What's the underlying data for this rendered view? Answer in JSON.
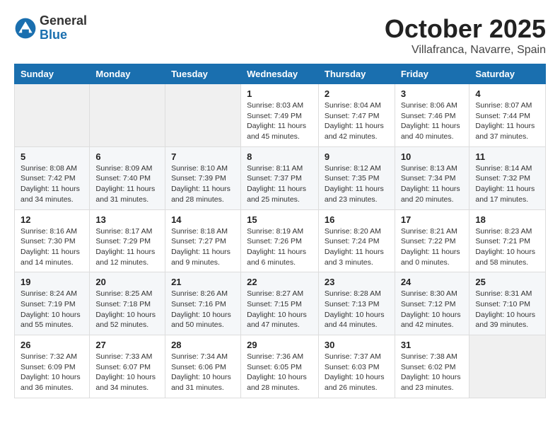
{
  "logo": {
    "general": "General",
    "blue": "Blue"
  },
  "title": "October 2025",
  "location": "Villafranca, Navarre, Spain",
  "days_of_week": [
    "Sunday",
    "Monday",
    "Tuesday",
    "Wednesday",
    "Thursday",
    "Friday",
    "Saturday"
  ],
  "weeks": [
    [
      {
        "day": "",
        "info": ""
      },
      {
        "day": "",
        "info": ""
      },
      {
        "day": "",
        "info": ""
      },
      {
        "day": "1",
        "info": "Sunrise: 8:03 AM\nSunset: 7:49 PM\nDaylight: 11 hours\nand 45 minutes."
      },
      {
        "day": "2",
        "info": "Sunrise: 8:04 AM\nSunset: 7:47 PM\nDaylight: 11 hours\nand 42 minutes."
      },
      {
        "day": "3",
        "info": "Sunrise: 8:06 AM\nSunset: 7:46 PM\nDaylight: 11 hours\nand 40 minutes."
      },
      {
        "day": "4",
        "info": "Sunrise: 8:07 AM\nSunset: 7:44 PM\nDaylight: 11 hours\nand 37 minutes."
      }
    ],
    [
      {
        "day": "5",
        "info": "Sunrise: 8:08 AM\nSunset: 7:42 PM\nDaylight: 11 hours\nand 34 minutes."
      },
      {
        "day": "6",
        "info": "Sunrise: 8:09 AM\nSunset: 7:40 PM\nDaylight: 11 hours\nand 31 minutes."
      },
      {
        "day": "7",
        "info": "Sunrise: 8:10 AM\nSunset: 7:39 PM\nDaylight: 11 hours\nand 28 minutes."
      },
      {
        "day": "8",
        "info": "Sunrise: 8:11 AM\nSunset: 7:37 PM\nDaylight: 11 hours\nand 25 minutes."
      },
      {
        "day": "9",
        "info": "Sunrise: 8:12 AM\nSunset: 7:35 PM\nDaylight: 11 hours\nand 23 minutes."
      },
      {
        "day": "10",
        "info": "Sunrise: 8:13 AM\nSunset: 7:34 PM\nDaylight: 11 hours\nand 20 minutes."
      },
      {
        "day": "11",
        "info": "Sunrise: 8:14 AM\nSunset: 7:32 PM\nDaylight: 11 hours\nand 17 minutes."
      }
    ],
    [
      {
        "day": "12",
        "info": "Sunrise: 8:16 AM\nSunset: 7:30 PM\nDaylight: 11 hours\nand 14 minutes."
      },
      {
        "day": "13",
        "info": "Sunrise: 8:17 AM\nSunset: 7:29 PM\nDaylight: 11 hours\nand 12 minutes."
      },
      {
        "day": "14",
        "info": "Sunrise: 8:18 AM\nSunset: 7:27 PM\nDaylight: 11 hours\nand 9 minutes."
      },
      {
        "day": "15",
        "info": "Sunrise: 8:19 AM\nSunset: 7:26 PM\nDaylight: 11 hours\nand 6 minutes."
      },
      {
        "day": "16",
        "info": "Sunrise: 8:20 AM\nSunset: 7:24 PM\nDaylight: 11 hours\nand 3 minutes."
      },
      {
        "day": "17",
        "info": "Sunrise: 8:21 AM\nSunset: 7:22 PM\nDaylight: 11 hours\nand 0 minutes."
      },
      {
        "day": "18",
        "info": "Sunrise: 8:23 AM\nSunset: 7:21 PM\nDaylight: 10 hours\nand 58 minutes."
      }
    ],
    [
      {
        "day": "19",
        "info": "Sunrise: 8:24 AM\nSunset: 7:19 PM\nDaylight: 10 hours\nand 55 minutes."
      },
      {
        "day": "20",
        "info": "Sunrise: 8:25 AM\nSunset: 7:18 PM\nDaylight: 10 hours\nand 52 minutes."
      },
      {
        "day": "21",
        "info": "Sunrise: 8:26 AM\nSunset: 7:16 PM\nDaylight: 10 hours\nand 50 minutes."
      },
      {
        "day": "22",
        "info": "Sunrise: 8:27 AM\nSunset: 7:15 PM\nDaylight: 10 hours\nand 47 minutes."
      },
      {
        "day": "23",
        "info": "Sunrise: 8:28 AM\nSunset: 7:13 PM\nDaylight: 10 hours\nand 44 minutes."
      },
      {
        "day": "24",
        "info": "Sunrise: 8:30 AM\nSunset: 7:12 PM\nDaylight: 10 hours\nand 42 minutes."
      },
      {
        "day": "25",
        "info": "Sunrise: 8:31 AM\nSunset: 7:10 PM\nDaylight: 10 hours\nand 39 minutes."
      }
    ],
    [
      {
        "day": "26",
        "info": "Sunrise: 7:32 AM\nSunset: 6:09 PM\nDaylight: 10 hours\nand 36 minutes."
      },
      {
        "day": "27",
        "info": "Sunrise: 7:33 AM\nSunset: 6:07 PM\nDaylight: 10 hours\nand 34 minutes."
      },
      {
        "day": "28",
        "info": "Sunrise: 7:34 AM\nSunset: 6:06 PM\nDaylight: 10 hours\nand 31 minutes."
      },
      {
        "day": "29",
        "info": "Sunrise: 7:36 AM\nSunset: 6:05 PM\nDaylight: 10 hours\nand 28 minutes."
      },
      {
        "day": "30",
        "info": "Sunrise: 7:37 AM\nSunset: 6:03 PM\nDaylight: 10 hours\nand 26 minutes."
      },
      {
        "day": "31",
        "info": "Sunrise: 7:38 AM\nSunset: 6:02 PM\nDaylight: 10 hours\nand 23 minutes."
      },
      {
        "day": "",
        "info": ""
      }
    ]
  ]
}
